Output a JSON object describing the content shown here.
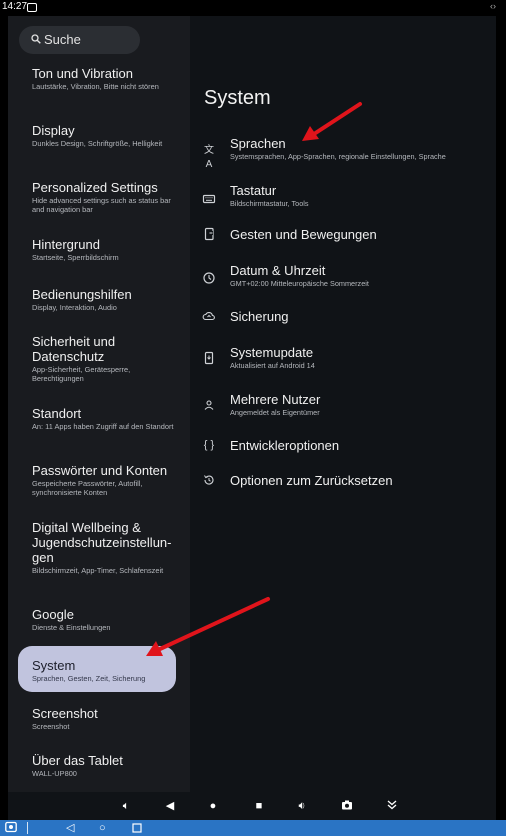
{
  "status_bar": {
    "time": "14:27",
    "right_indicator": "‹›"
  },
  "search": {
    "label": "Suche"
  },
  "sidebar": {
    "items": [
      {
        "title": "Ton und Vibration",
        "subtitle": "Lautstärke, Vibration, Bitte nicht stören"
      },
      {
        "title": "Display",
        "subtitle": "Dunkles Design, Schriftgröße, Helligkeit"
      },
      {
        "title": "Personalized Settings",
        "subtitle": "Hide advanced settings such as status bar and navigation bar"
      },
      {
        "title": "Hintergrund",
        "subtitle": "Startseite, Sperrbildschirm"
      },
      {
        "title": "Bedienungshilfen",
        "subtitle": "Display, Interaktion, Audio"
      },
      {
        "title": "Sicherheit und Datenschutz",
        "subtitle": "App-Sicherheit, Gerätesperre, Berechtigungen"
      },
      {
        "title": "Standort",
        "subtitle": "An: 11 Apps haben Zugriff auf den Standort"
      },
      {
        "title": "Passwörter und Konten",
        "subtitle": "Gespeicherte Passwörter, Autofill, synchronisierte Konten"
      },
      {
        "title": "Digital Wellbeing & Jugendschutzeinstellun-gen",
        "subtitle": "Bildschirmzeit, App-Timer, Schlafenszeit"
      },
      {
        "title": "Google",
        "subtitle": "Dienste & Einstellungen"
      },
      {
        "title": "System",
        "subtitle": "Sprachen, Gesten, Zeit, Sicherung",
        "selected": true
      },
      {
        "title": "Screenshot",
        "subtitle": "Screenshot"
      },
      {
        "title": "Über das Tablet",
        "subtitle": "WALL-UP800"
      }
    ]
  },
  "main": {
    "title": "System",
    "items": [
      {
        "icon": "translate-icon",
        "title": "Sprachen",
        "subtitle": "Systemsprachen, App-Sprachen, regionale Einstellungen, Sprache"
      },
      {
        "icon": "keyboard-icon",
        "title": "Tastatur",
        "subtitle": "Bildschirmtastatur, Tools"
      },
      {
        "icon": "gesture-icon",
        "title": "Gesten und Bewegungen",
        "subtitle": ""
      },
      {
        "icon": "clock-icon",
        "title": "Datum & Uhrzeit",
        "subtitle": "GMT+02:00 Mitteleuropäische Sommerzeit"
      },
      {
        "icon": "cloud-backup-icon",
        "title": "Sicherung",
        "subtitle": ""
      },
      {
        "icon": "system-update-icon",
        "title": "Systemupdate",
        "subtitle": "Aktualisiert auf Android 14"
      },
      {
        "icon": "users-icon",
        "title": "Mehrere Nutzer",
        "subtitle": "Angemeldet als Eigentümer"
      },
      {
        "icon": "developer-braces-icon",
        "title": "Entwickleroptionen",
        "subtitle": ""
      },
      {
        "icon": "reset-icon",
        "title": "Optionen zum Zurücksetzen",
        "subtitle": ""
      }
    ]
  },
  "colors": {
    "sidebar_bg": "#191b1f",
    "main_bg": "#101317",
    "selected_bg": "#c1c4de",
    "annotation_arrow": "#e0141b",
    "taskbar_bg": "#2a74c4"
  },
  "nav_bar": {
    "icons": [
      "volume-down-icon",
      "back-triangle-icon",
      "home-circle-icon",
      "recents-square-icon",
      "volume-up-icon",
      "camera-icon",
      "collapse-chevron-icon"
    ]
  },
  "taskbar": {
    "icons": [
      "app-icon",
      "back-icon",
      "home-icon",
      "recents-icon"
    ]
  }
}
